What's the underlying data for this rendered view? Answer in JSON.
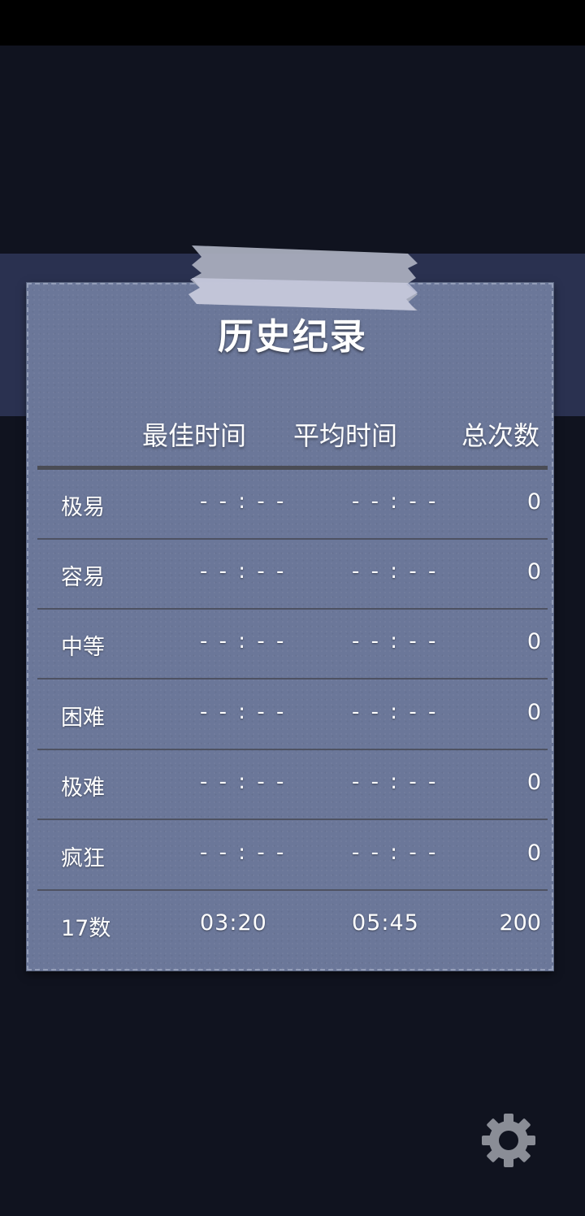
{
  "title": "历史纪录",
  "columns": {
    "best": "最佳时间",
    "average": "平均时间",
    "total": "总次数"
  },
  "rows": [
    {
      "label": "极易",
      "best": "- - : - -",
      "average": "- - : - -",
      "count": "0"
    },
    {
      "label": "容易",
      "best": "- - : - -",
      "average": "- - : - -",
      "count": "0"
    },
    {
      "label": "中等",
      "best": "- - : - -",
      "average": "- - : - -",
      "count": "0"
    },
    {
      "label": "困难",
      "best": "- - : - -",
      "average": "- - : - -",
      "count": "0"
    },
    {
      "label": "极难",
      "best": "- - : - -",
      "average": "- - : - -",
      "count": "0"
    },
    {
      "label": "疯狂",
      "best": "- - : - -",
      "average": "- - : - -",
      "count": "0"
    }
  ],
  "summary": {
    "label": "17数",
    "best": "03:20",
    "average": "05:45",
    "count": "200"
  },
  "icons": {
    "settings": "gear-icon"
  },
  "colors": {
    "background": "#10131f",
    "band": "#2a3150",
    "card": "#6b7799",
    "text": "#ffffff"
  }
}
